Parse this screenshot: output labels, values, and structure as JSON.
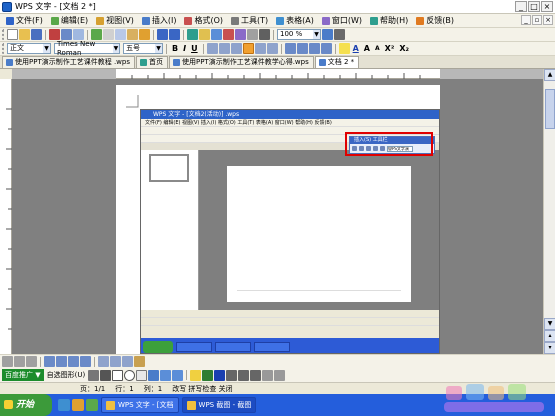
{
  "window": {
    "title": "WPS 文字 - [文档 2 *]"
  },
  "menubar": {
    "items": [
      "文件(F)",
      "编辑(E)",
      "视图(V)",
      "插入(I)",
      "格式(O)",
      "工具(T)",
      "表格(A)",
      "窗口(W)",
      "帮助(H)",
      "反馈(B)"
    ]
  },
  "toolbar": {
    "zoom": "100 %",
    "style": "正文",
    "font": "Times New Roman",
    "size": "五号",
    "bold": "B",
    "italic": "I",
    "underline": "U",
    "char_a": "A",
    "superscript": "X²",
    "subscript": "X₂"
  },
  "tabs": [
    {
      "label": "使用PPT演示制作工艺课件教程 .wps"
    },
    {
      "label": "首页"
    },
    {
      "label": "使用PPT演示制作工艺课件教学心得.wps"
    },
    {
      "label": "文档 2 *"
    }
  ],
  "embedded": {
    "title": "WPS 文字 - [文档2(活动)] .wps",
    "menu": "文件(F) 编辑(E) 视图(V) 插入(I) 格式(O) 工具(T) 表格(A) 窗口(W) 帮助(H) 反馈(B)",
    "float_title": "插入(S) 工具栏",
    "float_combo": "WPS文字演示"
  },
  "drawing_toolbar": {
    "badge": "百度推广 ▼",
    "label": "自选图形(U)"
  },
  "status": {
    "page": "页：1/1",
    "line": "行：1",
    "col": "列：1",
    "modes": "改写  拼写检查  关闭"
  },
  "taskbar": {
    "start": "开始",
    "tasks": [
      {
        "label": "WPS 文字 - [文档",
        "active": false
      },
      {
        "label": "WPS 截图 - 截图",
        "active": true
      }
    ]
  }
}
